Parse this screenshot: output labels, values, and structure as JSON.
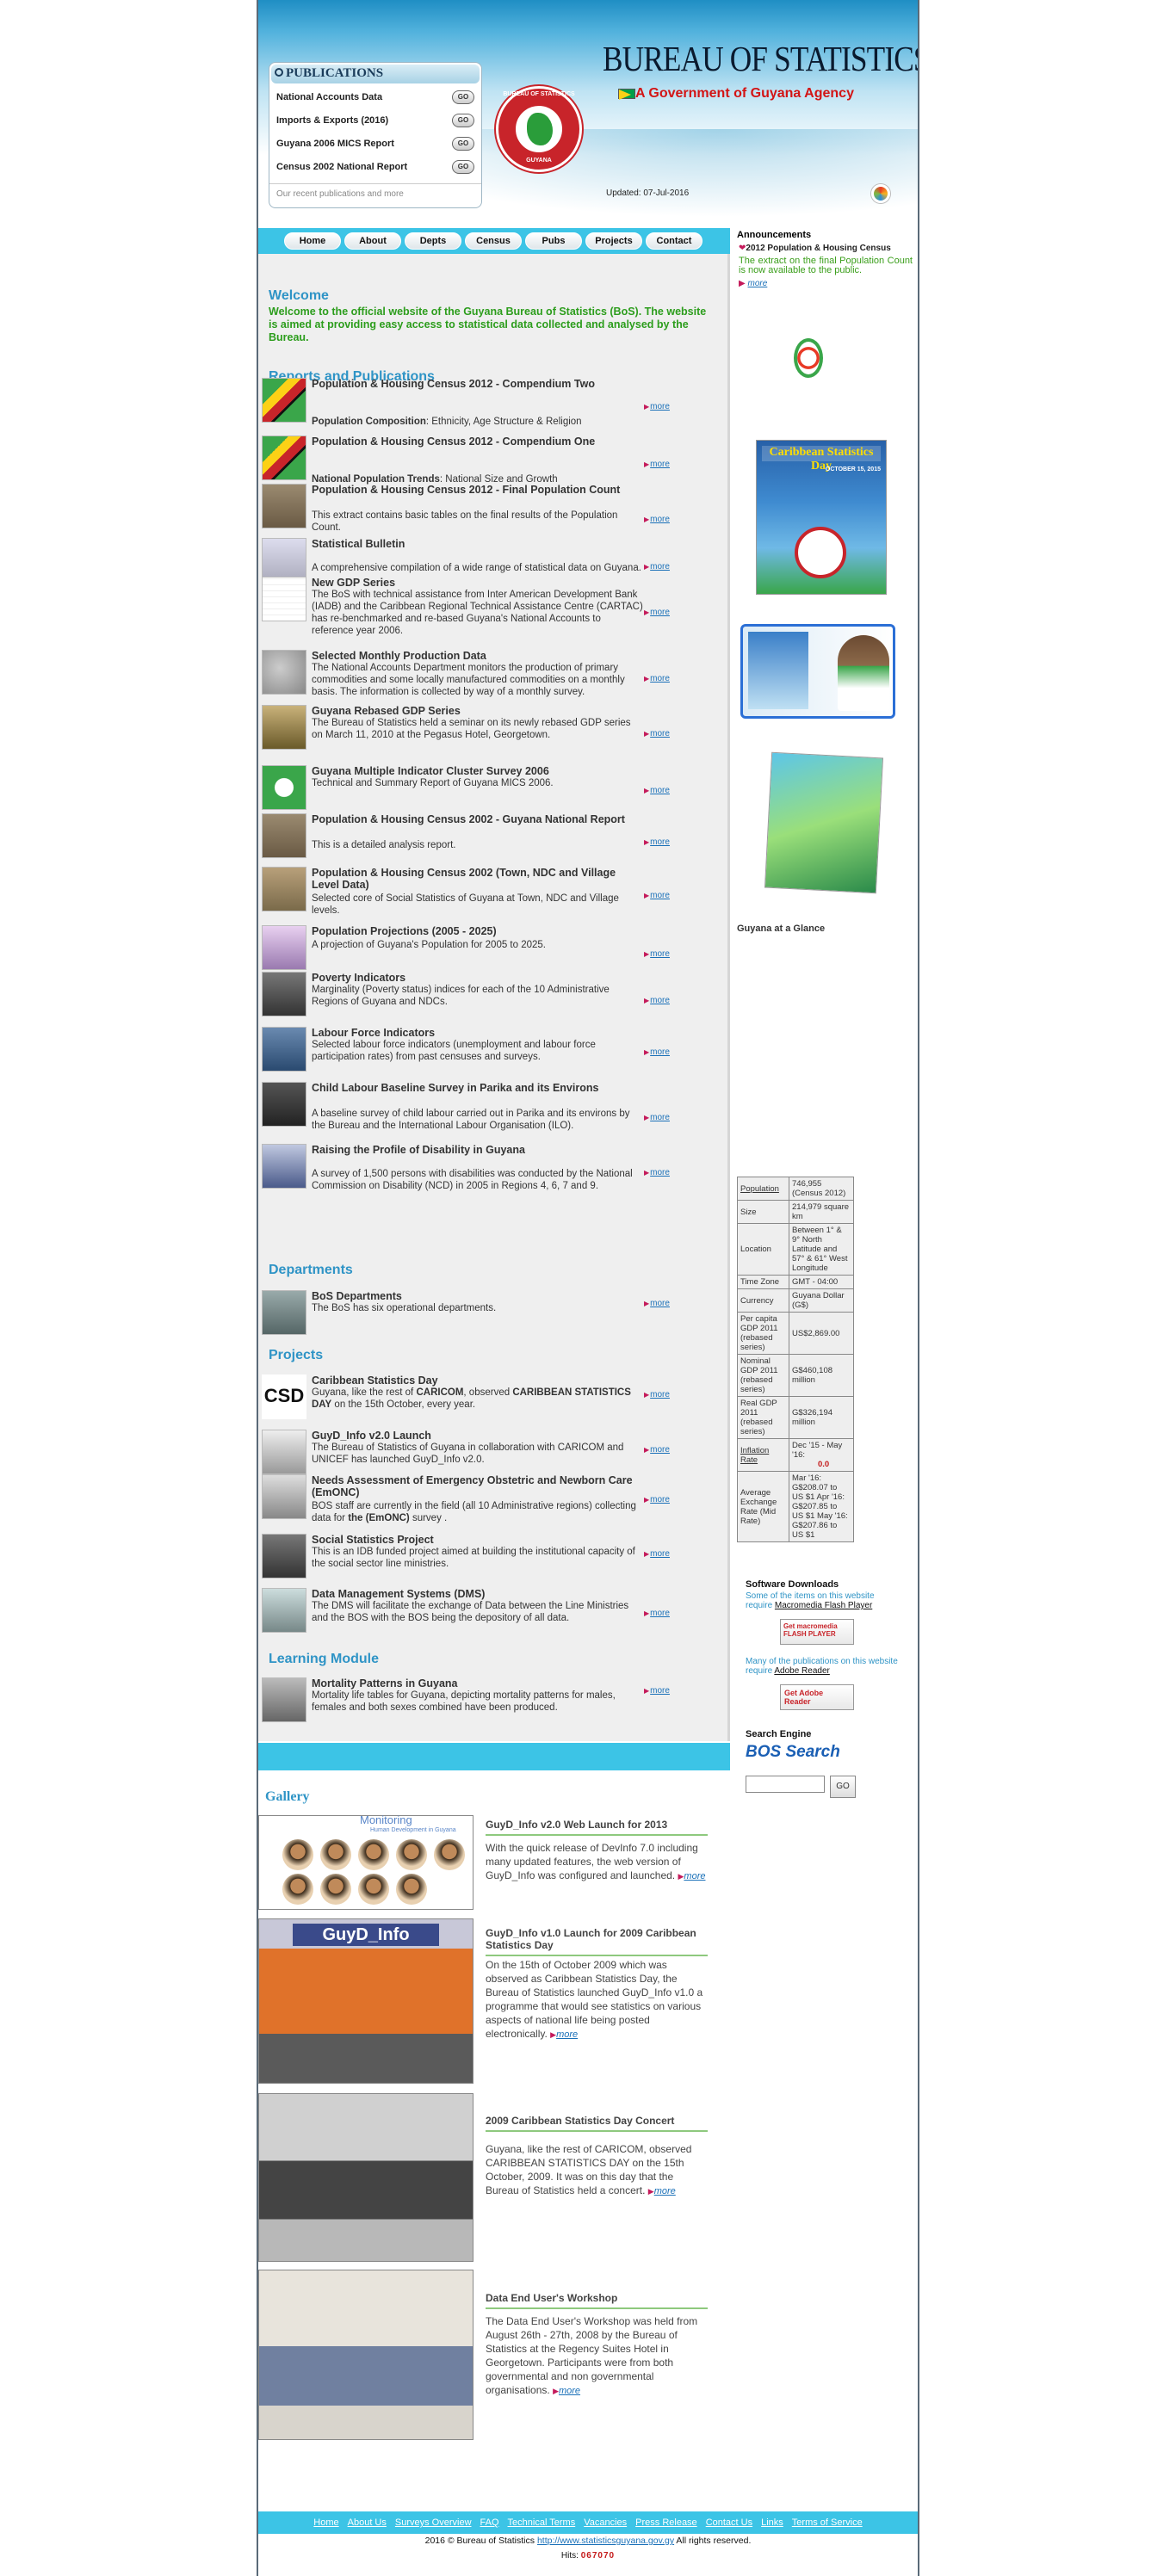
{
  "header": {
    "title": "BUREAU OF STATISTICS",
    "subtitle": "A Government of Guyana Agency",
    "updated": "Updated: 07-Jul-2016",
    "seal_top": "BUREAU OF STATISTICS",
    "seal_bottom": "GUYANA"
  },
  "publications": {
    "heading": "PUBLICATIONS",
    "items": [
      "National Accounts Data",
      "Imports & Exports (2016)",
      "Guyana 2006 MICS Report",
      "Census 2002 National Report"
    ],
    "go": "GO",
    "recent": "Our recent publications and more"
  },
  "nav": [
    "Home",
    "About",
    "Depts",
    "Census",
    "Pubs",
    "Projects",
    "Contact"
  ],
  "welcome": {
    "heading": "Welcome",
    "text": "Welcome to the official website of the Guyana Bureau of Statistics (BoS). The website is aimed at providing easy access to statistical data collected and analysed by the Bureau."
  },
  "reports": {
    "heading": "Reports and Publications",
    "items": [
      {
        "title": "Population & Housing Census 2012 - Compendium Two",
        "desc_bold": "Population Composition",
        "desc": ": Ethnicity, Age Structure & Religion"
      },
      {
        "title": "Population & Housing Census 2012 - Compendium One",
        "desc_bold": "National Population Trends",
        "desc": ": National Size and Growth"
      },
      {
        "title": "Population & Housing Census 2012 - Final Population Count",
        "desc": "This extract contains basic tables on the final results of the Population Count."
      },
      {
        "title": "Statistical Bulletin",
        "desc": "A comprehensive compilation of a wide range of statistical data on Guyana."
      },
      {
        "title": "New GDP Series",
        "desc": "The BoS with technical assistance from Inter American Development Bank (IADB) and the Caribbean Regional Technical Assistance Centre (CARTAC) has re-benchmarked and re-based Guyana's National Accounts to reference year 2006."
      },
      {
        "title": "Selected Monthly Production Data",
        "desc": "The National Accounts Department monitors the production of primary commodities and some locally manufactured commodities on a monthly basis. The information is collected by way of a monthly survey."
      },
      {
        "title": "Guyana Rebased GDP Series",
        "desc": "The Bureau of Statistics held a seminar on its newly rebased GDP series on March 11, 2010 at the Pegasus Hotel, Georgetown."
      },
      {
        "title": "Guyana Multiple Indicator Cluster Survey 2006",
        "desc": "Technical and Summary Report of Guyana MICS 2006."
      },
      {
        "title": "Population & Housing Census 2002 - Guyana National Report",
        "desc": "This is a detailed analysis report."
      },
      {
        "title": "Population & Housing Census 2002 (Town, NDC and Village Level Data)",
        "desc": "Selected core of Social Statistics of Guyana at Town, NDC and Village levels."
      },
      {
        "title": "Population Projections (2005 - 2025)",
        "desc": "A projection of Guyana's Population for 2005 to 2025."
      },
      {
        "title": "Poverty Indicators",
        "desc": "Marginality (Poverty status) indices for each of the 10 Administrative Regions of Guyana and NDCs."
      },
      {
        "title": "Labour Force Indicators",
        "desc": "Selected labour force indicators (unemployment and labour force participation rates) from past censuses and surveys."
      },
      {
        "title": "Child Labour Baseline Survey in Parika and its Environs",
        "desc": "A baseline survey of child labour carried out in Parika and its environs by the Bureau and the International Labour Organisation (ILO)."
      },
      {
        "title": "Raising the Profile of Disability in Guyana",
        "desc": "A survey of 1,500 persons with disabilities was conducted by the National Commission on Disability (NCD) in 2005 in Regions 4, 6, 7 and 9."
      }
    ]
  },
  "departments": {
    "heading": "Departments",
    "items": [
      {
        "title": "BoS Departments",
        "desc": "The BoS has six operational departments."
      }
    ]
  },
  "projects": {
    "heading": "Projects",
    "items": [
      {
        "title": "Caribbean Statistics Day",
        "desc_a": "Guyana, like the rest of ",
        "desc_b": "CARICOM",
        "desc_c": ", observed ",
        "desc_d": "CARIBBEAN STATISTICS DAY",
        "desc_e": " on the 15th October, every year."
      },
      {
        "title": "GuyD_Info v2.0 Launch",
        "desc": "The Bureau of Statistics of Guyana in collaboration with CARICOM and UNICEF has launched GuyD_Info v2.0."
      },
      {
        "title": "Needs Assessment of Emergency Obstetric and Newborn Care (EmONC)",
        "desc_a": "BOS staff are currently in the field (all 10 Administrative regions) collecting data for ",
        "desc_b": "the (EmONC)",
        "desc_c": " survey ."
      },
      {
        "title": "Social Statistics Project",
        "desc": "This is an IDB funded project aimed at building the institutional capacity of the social sector line ministries."
      },
      {
        "title": "Data Management Systems (DMS)",
        "desc": "The DMS will facilitate the exchange of Data between the Line Ministries and the BOS with the BOS being the depository of all data."
      }
    ]
  },
  "learning": {
    "heading": "Learning Module",
    "items": [
      {
        "title": "Mortality Patterns in Guyana",
        "desc": "Mortality life tables for Guyana, depicting mortality patterns for males, females and both sexes combined have been produced."
      }
    ]
  },
  "more_label": "more",
  "gallery": {
    "heading": "Gallery",
    "monitoring": "Monitoring",
    "monitoring_sub": "Human Development in Guyana",
    "items": [
      {
        "title": "GuyD_Info v2.0 Web Launch for 2013",
        "desc": "With the quick release of DevInfo 7.0 including many updated features, the web version of GuyD_Info was configured and launched."
      },
      {
        "title": "GuyD_Info v1.0 Launch for 2009 Caribbean Statistics Day",
        "desc": "On the 15th of October 2009 which was observed as Caribbean Statistics Day, the Bureau of Statistics launched GuyD_Info v1.0 a programme that would see statistics on various aspects of national life being posted electronically."
      },
      {
        "title": "2009 Caribbean Statistics Day Concert",
        "desc": "Guyana, like the rest of CARICOM, observed CARIBBEAN STATISTICS DAY on the 15th October, 2009. It was on this day that the Bureau of Statistics held a concert."
      },
      {
        "title": "Data End User's Workshop",
        "desc": "The Data End User's Workshop was held from August 26th - 27th, 2008 by the Bureau of Statistics at the Regency Suites Hotel in Georgetown. Participants were from both governmental and non governmental organisations."
      }
    ],
    "launch_banner": "GuyD_Info"
  },
  "sidebar": {
    "announcements": "Announcements",
    "ann_title": "2012 Population & Housing Census",
    "ann_text": "The extract on the final Population Count is now available to the public.",
    "ann_more": "more",
    "ad_csd": "Caribbean Statistics Day",
    "ad_csd_date": "OCTOBER 15, 2015",
    "glance": "Guyana at a Glance",
    "facts": [
      {
        "k": "Population",
        "v": "746,955  (Census 2012)",
        "link": true
      },
      {
        "k": "Size",
        "v": "214,979 square km"
      },
      {
        "k": "Location",
        "v": "Between 1° & 9° North Latitude and 57° & 61° West Longitude"
      },
      {
        "k": "Time Zone",
        "v": "GMT - 04:00"
      },
      {
        "k": "Currency",
        "v": "Guyana Dollar (G$)"
      },
      {
        "k": "Per capita GDP 2011 (rebased series)",
        "v": "US$2,869.00"
      },
      {
        "k": "Nominal GDP 2011 (rebased series)",
        "v": "G$460,108  million"
      },
      {
        "k": "Real GDP 2011 (rebased series)",
        "v": "G$326,194  million"
      },
      {
        "k": "Inflation Rate",
        "v": "Dec '15 - May '16:",
        "v2": "0.0",
        "link": true
      },
      {
        "k": "Average Exchange Rate (Mid Rate)",
        "v": "Mar '16: G$208.07 to US $1 Apr '16: G$207.85 to US $1 May '16: G$207.86 to US $1"
      }
    ],
    "sw_heading": "Software Downloads",
    "sw_text1": "Some of the items on this website require ",
    "sw_link1": "Macromedia Flash Player",
    "flash_btn": "Get macromedia FLASH PLAYER",
    "sw_text2": "Many of the publications on this website require ",
    "sw_link2": "Adobe Reader",
    "adobe_btn": "Get Adobe Reader",
    "search_heading": "Search Engine",
    "search_logo": "BOS Search",
    "search_go": "GO"
  },
  "footer": {
    "links": [
      "Home",
      "About Us",
      "Surveys Overview",
      "FAQ",
      "Technical Terms",
      "Vacancies",
      "Press Release",
      "Contact Us",
      "Links",
      "Terms of Service"
    ],
    "copyright": "2016 © Bureau of Statistics ",
    "url": "http://www.statisticsguyana.gov.gy",
    "rights": " All rights reserved.",
    "hits_label": "Hits: ",
    "hits": "067070"
  },
  "colors": {
    "accent": "#3cc4e6",
    "green_text": "#2c9d1c",
    "red_text": "#d31414",
    "link": "#1a70b8"
  }
}
